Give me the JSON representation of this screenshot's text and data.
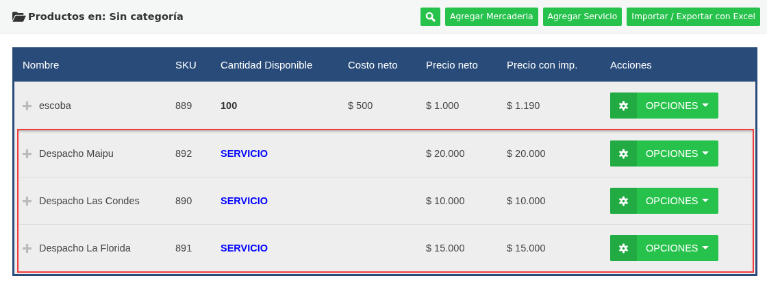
{
  "header": {
    "title": "Productos en: Sin categoría",
    "buttons": [
      {
        "kind": "search"
      },
      {
        "kind": "text",
        "label": "Agregar Mercaderia"
      },
      {
        "kind": "text",
        "label": "Agregar Servicio"
      },
      {
        "kind": "text",
        "label": "Importar / Exportar con Excel"
      }
    ]
  },
  "table": {
    "columns": [
      "Nombre",
      "SKU",
      "Cantidad Disponible",
      "Costo neto",
      "Precio neto",
      "Precio con imp.",
      "Acciones"
    ],
    "rows": [
      {
        "name": "escoba",
        "sku": "889",
        "quantity": {
          "kind": "stock",
          "text": "100"
        },
        "cost": "$ 500",
        "price": "$ 1.000",
        "price_tax": "$ 1.190",
        "action": "OPCIONES",
        "highlighted": false
      },
      {
        "name": "Despacho Maipu",
        "sku": "892",
        "quantity": {
          "kind": "service",
          "text": "SERVICIO"
        },
        "price": "$ 20.000",
        "price_tax": "$ 20.000",
        "action": "OPCIONES",
        "highlighted": true
      },
      {
        "name": "Despacho Las Condes",
        "sku": "890",
        "quantity": {
          "kind": "service",
          "text": "SERVICIO"
        },
        "price": "$ 10.000",
        "price_tax": "$ 10.000",
        "action": "OPCIONES",
        "highlighted": true
      },
      {
        "name": "Despacho La Florida",
        "sku": "891",
        "quantity": {
          "kind": "service",
          "text": "SERVICIO"
        },
        "price": "$ 15.000",
        "price_tax": "$ 15.000",
        "action": "OPCIONES",
        "highlighted": true
      }
    ]
  }
}
